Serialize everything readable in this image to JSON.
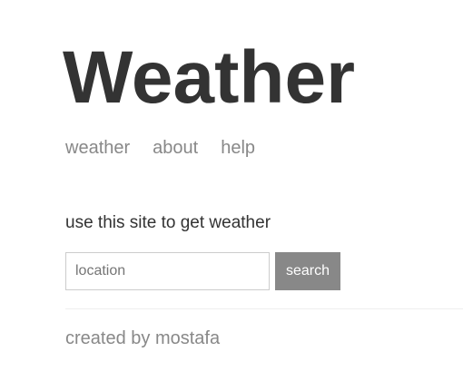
{
  "header": {
    "title": "Weather"
  },
  "nav": {
    "items": [
      {
        "label": "weather"
      },
      {
        "label": "about"
      },
      {
        "label": "help"
      }
    ]
  },
  "main": {
    "intro_text": "use this site to get weather",
    "search": {
      "value": "",
      "placeholder": "location",
      "button_label": "search"
    }
  },
  "footer": {
    "text": "created by mostafa"
  },
  "colors": {
    "text_primary": "#333333",
    "text_muted": "#888888",
    "button_background": "#888888",
    "button_text": "#ffffff",
    "input_border": "#cccccc",
    "divider": "#eeeeee",
    "background": "#ffffff"
  }
}
